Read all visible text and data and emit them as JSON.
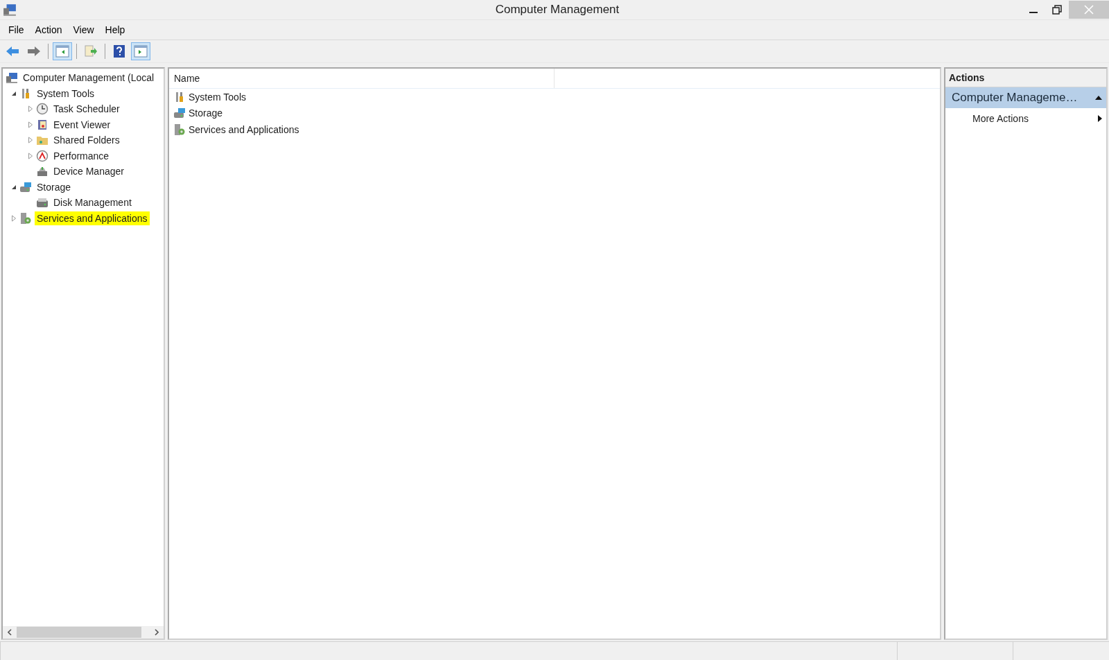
{
  "window": {
    "title": "Computer Management"
  },
  "menu": [
    "File",
    "Action",
    "View",
    "Help"
  ],
  "toolbar": [
    [
      {
        "kind": "back",
        "pressed": false
      },
      {
        "kind": "forward",
        "pressed": false
      }
    ],
    [
      {
        "kind": "tree",
        "pressed": true
      }
    ],
    [
      {
        "kind": "export",
        "pressed": false
      }
    ],
    [
      {
        "kind": "help",
        "pressed": false
      },
      {
        "kind": "actionpane",
        "pressed": true
      }
    ]
  ],
  "tree": [
    {
      "label": "Computer Management (Local",
      "kind": "computer",
      "highlighted": false,
      "children": [
        {
          "label": "System Tools",
          "kind": "tools",
          "expanded": true,
          "highlighted": false,
          "children": [
            {
              "label": "Task Scheduler",
              "kind": "clock",
              "expanded": false,
              "highlighted": false
            },
            {
              "label": "Event Viewer",
              "kind": "event",
              "expanded": false,
              "highlighted": false
            },
            {
              "label": "Shared Folders",
              "kind": "folder",
              "expanded": false,
              "highlighted": false
            },
            {
              "label": "Performance",
              "kind": "performance",
              "expanded": false,
              "highlighted": false
            },
            {
              "label": "Device Manager",
              "kind": "device",
              "highlighted": false
            }
          ]
        },
        {
          "label": "Storage",
          "kind": "storage",
          "expanded": true,
          "highlighted": false,
          "children": [
            {
              "label": "Disk Management",
              "kind": "disk",
              "highlighted": false
            }
          ]
        },
        {
          "label": "Services and Applications",
          "kind": "services",
          "expanded": false,
          "highlighted": true
        }
      ]
    }
  ],
  "list": {
    "columns": [
      "Name"
    ],
    "rows": [
      {
        "name": "System Tools",
        "kind": "tools"
      },
      {
        "name": "Storage",
        "kind": "storage"
      },
      {
        "name": "Services and Applications",
        "kind": "services"
      }
    ]
  },
  "actions": {
    "title": "Actions",
    "section": {
      "label": "Computer Manageme…",
      "expanded": true
    },
    "items": [
      {
        "label": "More Actions"
      }
    ]
  }
}
